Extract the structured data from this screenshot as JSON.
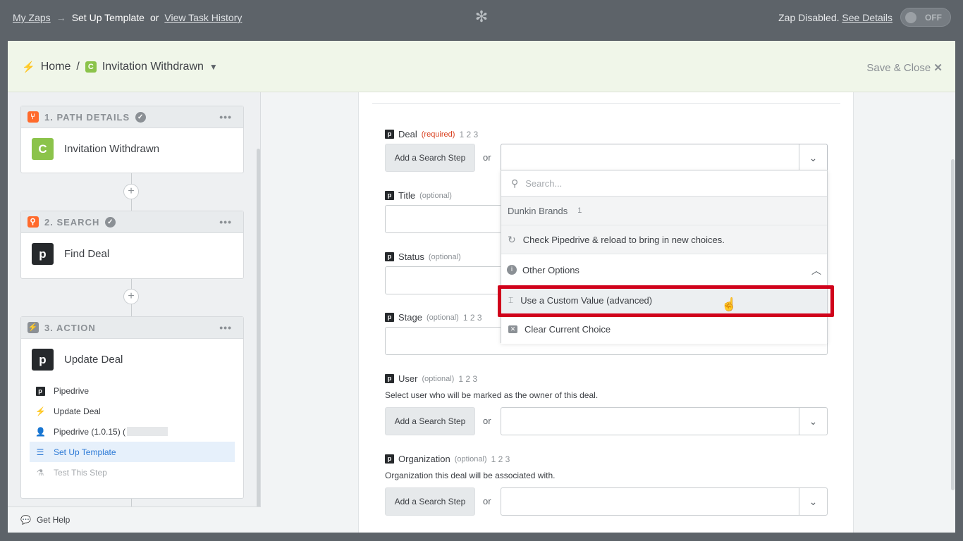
{
  "topbar": {
    "my_zaps": "My Zaps",
    "arrow": "→",
    "current": "Set Up Template",
    "or": "or",
    "task_history": "View Task History",
    "status_text": "Zap Disabled.",
    "see_details": "See Details",
    "toggle": "OFF"
  },
  "header": {
    "home": "Home",
    "sep": "/",
    "zap_name": "Invitation Withdrawn",
    "save_close": "Save & Close"
  },
  "sidebar": {
    "cards": [
      {
        "step": "1. PATH DETAILS",
        "title": "Invitation Withdrawn",
        "icon": "C"
      },
      {
        "step": "2. SEARCH",
        "title": "Find Deal",
        "icon": "p"
      },
      {
        "step": "3. ACTION",
        "title": "Update Deal",
        "icon": "p"
      }
    ],
    "subitems": [
      "Pipedrive",
      "Update Deal",
      "Pipedrive (1.0.15) (",
      "Set Up Template",
      "Test This Step"
    ],
    "get_help": "Get Help"
  },
  "form": {
    "deal": {
      "label": "Deal",
      "req": "(required)",
      "nums": "1 2 3"
    },
    "title": {
      "label": "Title",
      "opt": "(optional)"
    },
    "status": {
      "label": "Status",
      "opt": "(optional)"
    },
    "stage": {
      "label": "Stage",
      "opt": "(optional)",
      "nums": "1 2 3"
    },
    "user": {
      "label": "User",
      "opt": "(optional)",
      "nums": "1 2 3",
      "desc": "Select user who will be marked as the owner of this deal."
    },
    "organization": {
      "label": "Organization",
      "opt": "(optional)",
      "nums": "1 2 3",
      "desc": "Organization this deal will be associated with."
    },
    "search_step": "Add a Search Step",
    "or": "or"
  },
  "dropdown": {
    "placeholder": "Search...",
    "option": "Dunkin Brands",
    "option_badge": "1",
    "reload": "Check Pipedrive & reload to bring in new choices.",
    "other": "Other Options",
    "custom": "Use a Custom Value (advanced)",
    "clear": "Clear Current Choice"
  }
}
